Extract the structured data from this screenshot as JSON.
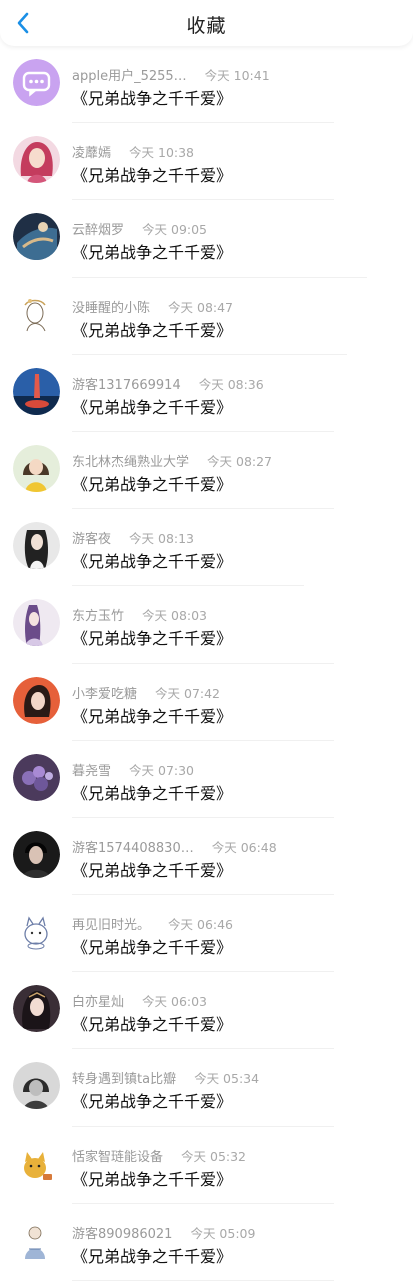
{
  "header": {
    "title": "收藏",
    "back_icon": "chevron-left-icon",
    "accent": "#1a8fe6"
  },
  "items": [
    {
      "name": "apple用户_5255…",
      "time": "今天 10:41",
      "text": "《兄弟战争之千千爱》",
      "avatar": "chat-bubble-icon"
    },
    {
      "name": "凌蘼嫣",
      "time": "今天 10:38",
      "text": "《兄弟战争之千千爱》",
      "avatar": "user-avatar"
    },
    {
      "name": "云醉烟罗",
      "time": "今天 09:05",
      "text": "《兄弟战争之千千爱》",
      "avatar": "user-avatar"
    },
    {
      "name": "没睡醒的小陈",
      "time": "今天 08:47",
      "text": "《兄弟战争之千千爱》",
      "avatar": "user-avatar"
    },
    {
      "name": "游客1317669914",
      "time": "今天 08:36",
      "text": "《兄弟战争之千千爱》",
      "avatar": "user-avatar"
    },
    {
      "name": "东北林杰绳熟业大学",
      "time": "今天 08:27",
      "text": "《兄弟战争之千千爱》",
      "avatar": "user-avatar"
    },
    {
      "name": "游客夜",
      "time": "今天 08:13",
      "text": "《兄弟战争之千千爱》",
      "avatar": "user-avatar"
    },
    {
      "name": "东方玉竹",
      "time": "今天 08:03",
      "text": "《兄弟战争之千千爱》",
      "avatar": "user-avatar"
    },
    {
      "name": "小李爱吃糖",
      "time": "今天 07:42",
      "text": "《兄弟战争之千千爱》",
      "avatar": "user-avatar"
    },
    {
      "name": "暮尧雪",
      "time": "今天 07:30",
      "text": "《兄弟战争之千千爱》",
      "avatar": "user-avatar"
    },
    {
      "name": "游客1574408830…",
      "time": "今天 06:48",
      "text": "《兄弟战争之千千爱》",
      "avatar": "user-avatar"
    },
    {
      "name": "再见旧时光。",
      "time": "今天 06:46",
      "text": "《兄弟战争之千千爱》",
      "avatar": "user-avatar"
    },
    {
      "name": "白亦星灿",
      "time": "今天 06:03",
      "text": "《兄弟战争之千千爱》",
      "avatar": "user-avatar"
    },
    {
      "name": "转身遇到镇ta比瓣",
      "time": "今天 05:34",
      "text": "《兄弟战争之千千爱》",
      "avatar": "user-avatar"
    },
    {
      "name": "恬家智琏能设备",
      "time": "今天 05:32",
      "text": "《兄弟战争之千千爱》",
      "avatar": "user-avatar"
    },
    {
      "name": "游客890986021",
      "time": "今天 05:09",
      "text": "《兄弟战争之千千爱》",
      "avatar": "user-avatar"
    }
  ]
}
